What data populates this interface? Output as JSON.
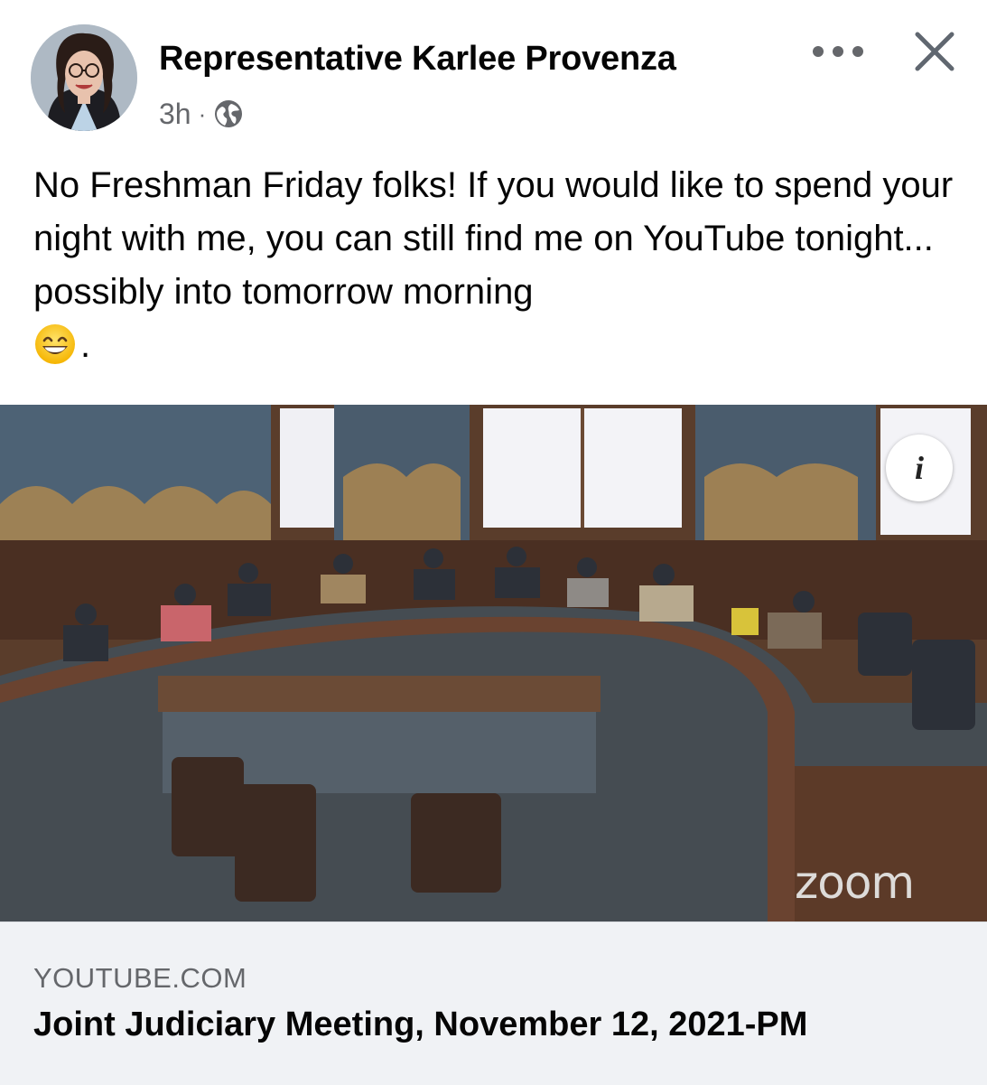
{
  "post": {
    "author_name": "Representative Karlee Provenza",
    "timestamp": "3h",
    "separator": "·",
    "privacy_icon": "globe-icon",
    "text": "No Freshman Friday folks! If you would like to spend your night with me, you can still find me on YouTube tonight... possibly into tomorrow morning",
    "text_emoji": "grinning-face-emoji",
    "text_end": "."
  },
  "actions": {
    "more_icon": "more-horizontal-icon",
    "close_icon": "close-icon"
  },
  "link_preview": {
    "domain": "YOUTUBE.COM",
    "title": "Joint Judiciary Meeting, November 12, 2021-PM",
    "info_label": "i",
    "watermark": "zoom"
  },
  "colors": {
    "secondary_text": "#65676b",
    "footer_bg": "#f0f2f5",
    "primary_text": "#050505"
  }
}
